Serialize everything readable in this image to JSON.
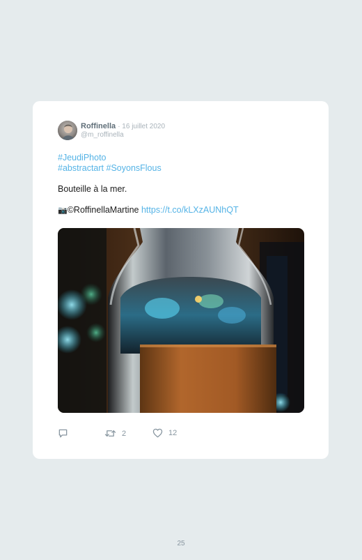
{
  "tweet": {
    "author_name": "Roffinella",
    "date": "· 16 juillet 2020",
    "handle": "@m_roffinella",
    "hashtags": [
      "#JeudiPhoto",
      "#abstractart",
      "#SoyonsFlous"
    ],
    "text": "Bouteille à la mer.",
    "camera_icon": "camera-icon",
    "copyright_credit": "©RoffinellaMartine",
    "link": "https://t.co/kLXzAUNhQT",
    "image_icon": "bottle-photo"
  },
  "actions": {
    "reply_icon": "reply-icon",
    "retweet_icon": "retweet-icon",
    "retweet_count": "2",
    "like_icon": "heart-icon",
    "like_count": "12"
  },
  "page": {
    "number": "25"
  },
  "colors": {
    "background": "#e5ebed",
    "card": "#ffffff",
    "link": "#54b3e6",
    "muted": "#a9b3ba"
  }
}
